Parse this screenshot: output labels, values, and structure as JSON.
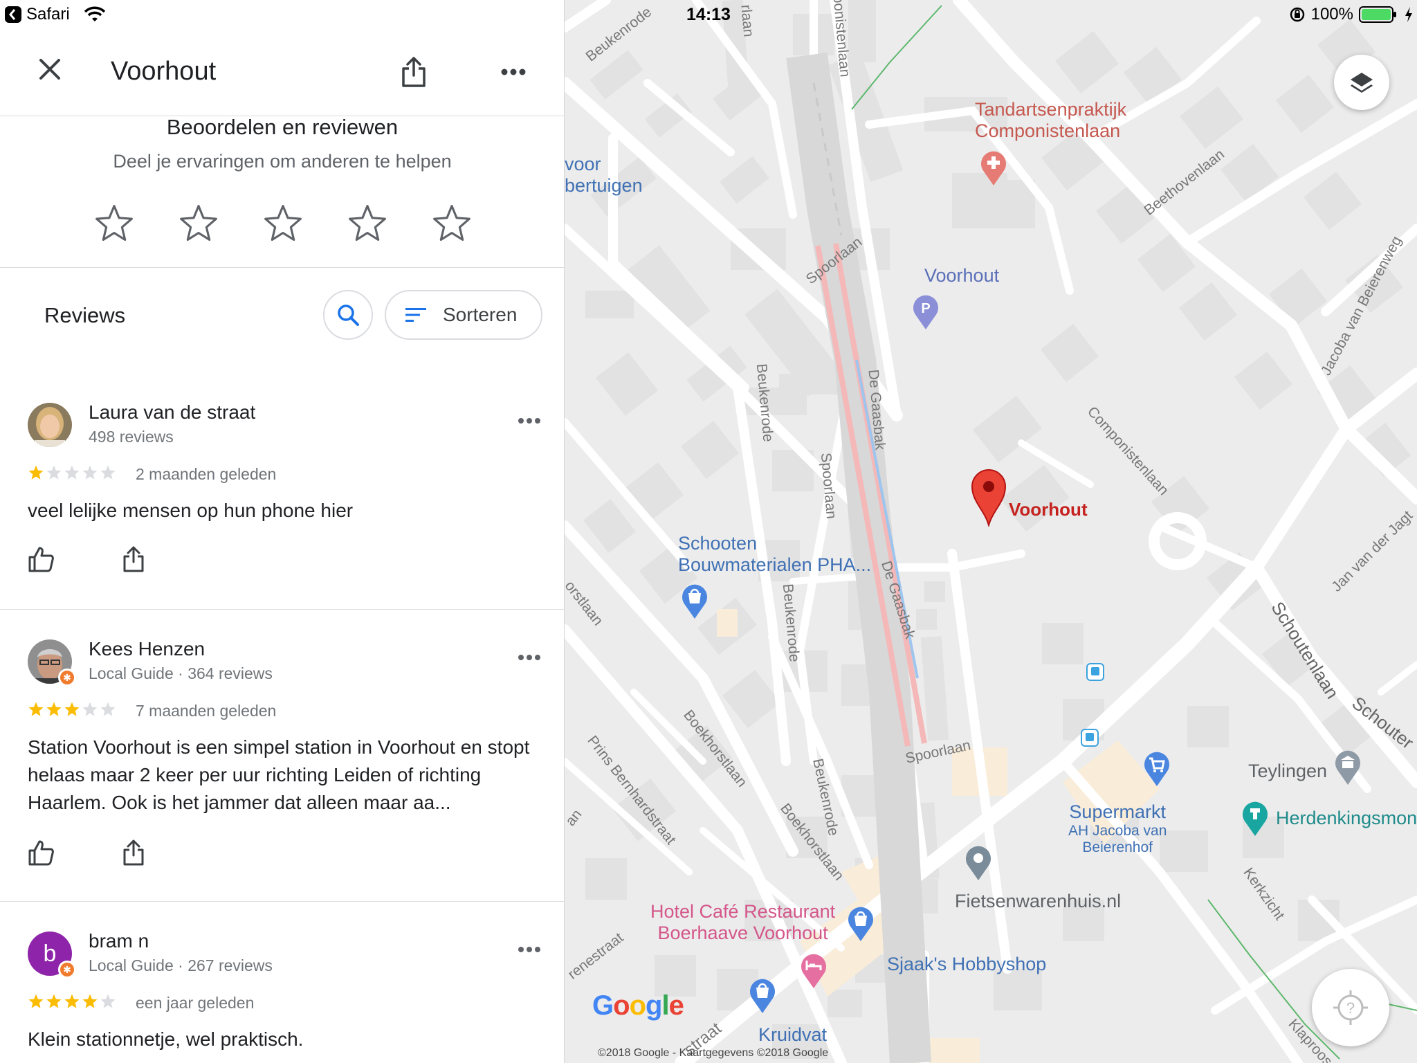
{
  "status_bar": {
    "back_app": "Safari",
    "time": "14:13",
    "battery": "100%"
  },
  "header": {
    "title": "Voorhout"
  },
  "rate": {
    "title": "Beoordelen en reviewen",
    "subtitle": "Deel je ervaringen om anderen te helpen",
    "star_count": 5
  },
  "reviews_section": {
    "heading": "Reviews",
    "sort_label": "Sorteren"
  },
  "reviews": [
    {
      "name": "Laura van de straat",
      "local_guide": false,
      "meta": "498 reviews",
      "rating": 1,
      "date": "2 maanden geleden",
      "text": "veel lelijke mensen op hun phone hier"
    },
    {
      "name": "Kees Henzen",
      "local_guide": true,
      "meta": "Local Guide · 364 reviews",
      "rating": 3,
      "date": "7 maanden geleden",
      "text": "Station Voorhout is een simpel station in Voorhout en stopt helaas maar 2 keer per uur richting Leiden of richting Haarlem. Ook is het jammer dat alleen maar aa..."
    },
    {
      "name": "bram n",
      "avatar_letter": "b",
      "local_guide": true,
      "meta": "Local Guide · 267 reviews",
      "rating": 4,
      "date": "een jaar geleden",
      "text": "Klein stationnetje, wel praktisch."
    }
  ],
  "map": {
    "streets": {
      "beukenrode_top": "Beukenrode",
      "laan_top": "rlaan",
      "componistenlaan_top": "ponistenlaan",
      "spoorlaan_1": "Spoorlaan",
      "beethovenlaan": "Beethovenlaan",
      "beukenrode_mid": "Beukenrode",
      "de_gaasbak_1": "De Gaasbak",
      "spoorlaan_2": "Spoorlaan",
      "componistenlaan_mid": "Componistenlaan",
      "jacoba": "Jacoba van Beierenweg",
      "jan_van_der": "Jan van der Jagt",
      "horstlaan_left": "orstlaan",
      "beukenrode_low": "Beukenrode",
      "de_gaasbak_2": "De Gaasbak",
      "schoutenlaan": "Schoutenlaan",
      "schouten_right": "Schouter",
      "boekhorstlaan_1": "Boekhorstlaan",
      "prins_bernhard": "Prins Bernhardstraat",
      "spoorlaan_3": "Spoorlaan",
      "beukenrode_bottom": "Beukenrode",
      "boekhorstlaan_2": "Boekhorstlaan",
      "an_left": "an",
      "kerkzicht": "Kerkzicht",
      "enestraat": "renestraat",
      "straat_bottom": "straat",
      "klaproos": "Klaproos"
    },
    "pois": {
      "voor_line1": "voor",
      "voor_line2": "bertuigen",
      "tandarts_line1": "Tandartsenpraktijk",
      "tandarts_line2": "Componistenlaan",
      "parking": "Voorhout",
      "station": "Voorhout",
      "schooten_line1": "Schooten",
      "schooten_line2": "Bouwmaterialen PHA...",
      "teylingen": "Teylingen",
      "supermarkt_line1": "Supermarkt",
      "supermarkt_line2": "AH Jacoba van",
      "supermarkt_line3": "Beierenhof",
      "herdenking": "Herdenkingsmon",
      "fietsen": "Fietsenwarenhuis.nl",
      "hotel_line1": "Hotel Café Restaurant",
      "hotel_line2": "Boerhaave Voorhout",
      "sjaak": "Sjaak's Hobbyshop",
      "kruidvat": "Kruidvat"
    },
    "logo": "Google",
    "copyright": "©2018 Google - Kaartgegevens ©2018 Google"
  },
  "colors": {
    "star_filled": "#fbbc04",
    "star_empty": "#dadce0",
    "accent_blue": "#1a73e8",
    "pin_red": "#ea4335"
  }
}
